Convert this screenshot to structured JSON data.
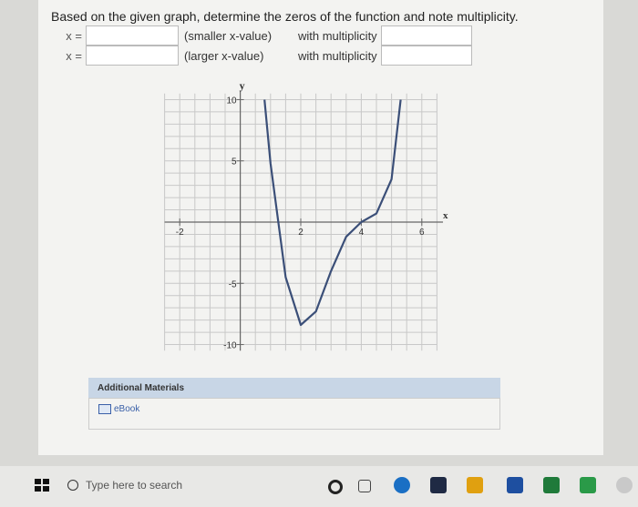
{
  "question": {
    "text": "Based on the given graph, determine the zeros of the function and note multiplicity.",
    "rows": [
      {
        "prefix": "x =",
        "hint": "(smaller x-value)",
        "mult_label": "with multiplicity",
        "zero_value": "",
        "mult_value": ""
      },
      {
        "prefix": "x =",
        "hint": "(larger x-value)",
        "mult_label": "with multiplicity",
        "zero_value": "",
        "mult_value": ""
      }
    ]
  },
  "chart_data": {
    "type": "line",
    "xlabel": "x",
    "ylabel": "y",
    "xlim": [
      -3,
      7
    ],
    "ylim": [
      -11,
      11
    ],
    "x_ticks": [
      {
        "value": -2,
        "label": "-2"
      },
      {
        "value": 2,
        "label": "2"
      },
      {
        "value": 4,
        "label": "4"
      },
      {
        "value": 6,
        "label": "6"
      }
    ],
    "y_ticks": [
      {
        "value": 10,
        "label": "10"
      },
      {
        "value": 5,
        "label": "5"
      },
      {
        "value": -5,
        "label": "-5"
      },
      {
        "value": -10,
        "label": "-10"
      }
    ],
    "grid": true,
    "series": [
      {
        "x": [
          0.8,
          1.0,
          1.5,
          2.0,
          2.5,
          3.0,
          3.5,
          4.0,
          4.5,
          5.0,
          5.3
        ],
        "y": [
          10,
          4.8,
          -4.5,
          -8.4,
          -7.3,
          -4.0,
          -1.2,
          0.0,
          0.7,
          3.5,
          10
        ]
      }
    ],
    "curve_color": "#3b4f78"
  },
  "materials": {
    "title": "Additional Materials",
    "ebook": "eBook"
  },
  "taskbar": {
    "search_placeholder": "Type here to search"
  }
}
